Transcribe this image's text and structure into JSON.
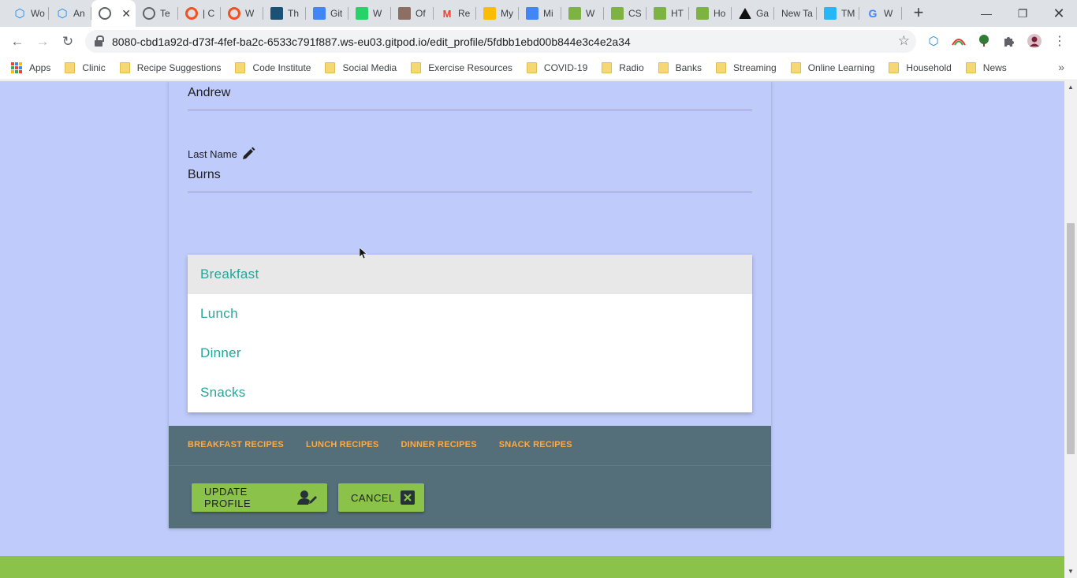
{
  "tabs": [
    {
      "title": "Wo",
      "icon": "hexagon-icon",
      "color": "#1e88e5"
    },
    {
      "title": "An",
      "icon": "hexagon-icon",
      "color": "#1e88e5"
    },
    {
      "title": "",
      "icon": "globe-icon",
      "color": "#5f6368",
      "active": true
    },
    {
      "title": "Te",
      "icon": "globe-icon",
      "color": "#5f6368"
    },
    {
      "title": "| C",
      "icon": "circle-icon",
      "color": "#f4511e"
    },
    {
      "title": "W",
      "icon": "circle-icon",
      "color": "#f4511e"
    },
    {
      "title": "Th",
      "icon": "w3-icon",
      "color": "#1a5276"
    },
    {
      "title": "Git",
      "icon": "doc-icon",
      "color": "#4285f4"
    },
    {
      "title": "W",
      "icon": "whatsapp-icon",
      "color": "#25d366"
    },
    {
      "title": "Of",
      "icon": "crest-icon",
      "color": "#8d6e63"
    },
    {
      "title": "Re",
      "icon": "gmail-icon",
      "color": "#ea4335"
    },
    {
      "title": "My",
      "icon": "drive-icon",
      "color": "#fbbc04"
    },
    {
      "title": "Mi",
      "icon": "doc-icon",
      "color": "#4285f4"
    },
    {
      "title": "W",
      "icon": "w3-icon",
      "color": "#7cb342"
    },
    {
      "title": "CS",
      "icon": "w3-icon",
      "color": "#7cb342"
    },
    {
      "title": "HT",
      "icon": "w3-icon",
      "color": "#7cb342"
    },
    {
      "title": "Ho",
      "icon": "w3-icon",
      "color": "#7cb342"
    },
    {
      "title": "Ga",
      "icon": "triangle-icon",
      "color": "#111111"
    },
    {
      "title": "New Ta",
      "icon": "",
      "color": ""
    },
    {
      "title": "TM",
      "icon": "tm-icon",
      "color": "#29b6f6"
    },
    {
      "title": "W",
      "icon": "google-icon",
      "color": "#4285f4"
    }
  ],
  "address": {
    "url": "8080-cbd1a92d-d73f-4fef-ba2c-6533c791f887.ws-eu03.gitpod.io/edit_profile/5fdbb1ebd00b844e3c4e2a34"
  },
  "bookmarks": {
    "apps_label": "Apps",
    "folders": [
      "Clinic",
      "Recipe Suggestions",
      "Code Institute",
      "Social Media",
      "Exercise Resources",
      "COVID-19",
      "Radio",
      "Banks",
      "Streaming",
      "Online Learning",
      "Household",
      "News"
    ]
  },
  "form": {
    "first_name_value": "Andrew",
    "last_name_label": "Last Name",
    "last_name_value": "Burns"
  },
  "dropdown": {
    "options": [
      "Breakfast",
      "Lunch",
      "Dinner",
      "Snacks"
    ],
    "selected": "Breakfast"
  },
  "card_links": [
    "BREAKFAST RECIPES",
    "LUNCH RECIPES",
    "DINNER RECIPES",
    "SNACK RECIPES"
  ],
  "buttons": {
    "update_label": "UPDATE PROFILE",
    "cancel_label": "CANCEL"
  },
  "colors": {
    "page_bg": "#bfcbfb",
    "card_action_bg": "#546e7a",
    "link_accent": "#ffab40",
    "button_green": "#8bc34a",
    "dropdown_text": "#26a69a"
  }
}
